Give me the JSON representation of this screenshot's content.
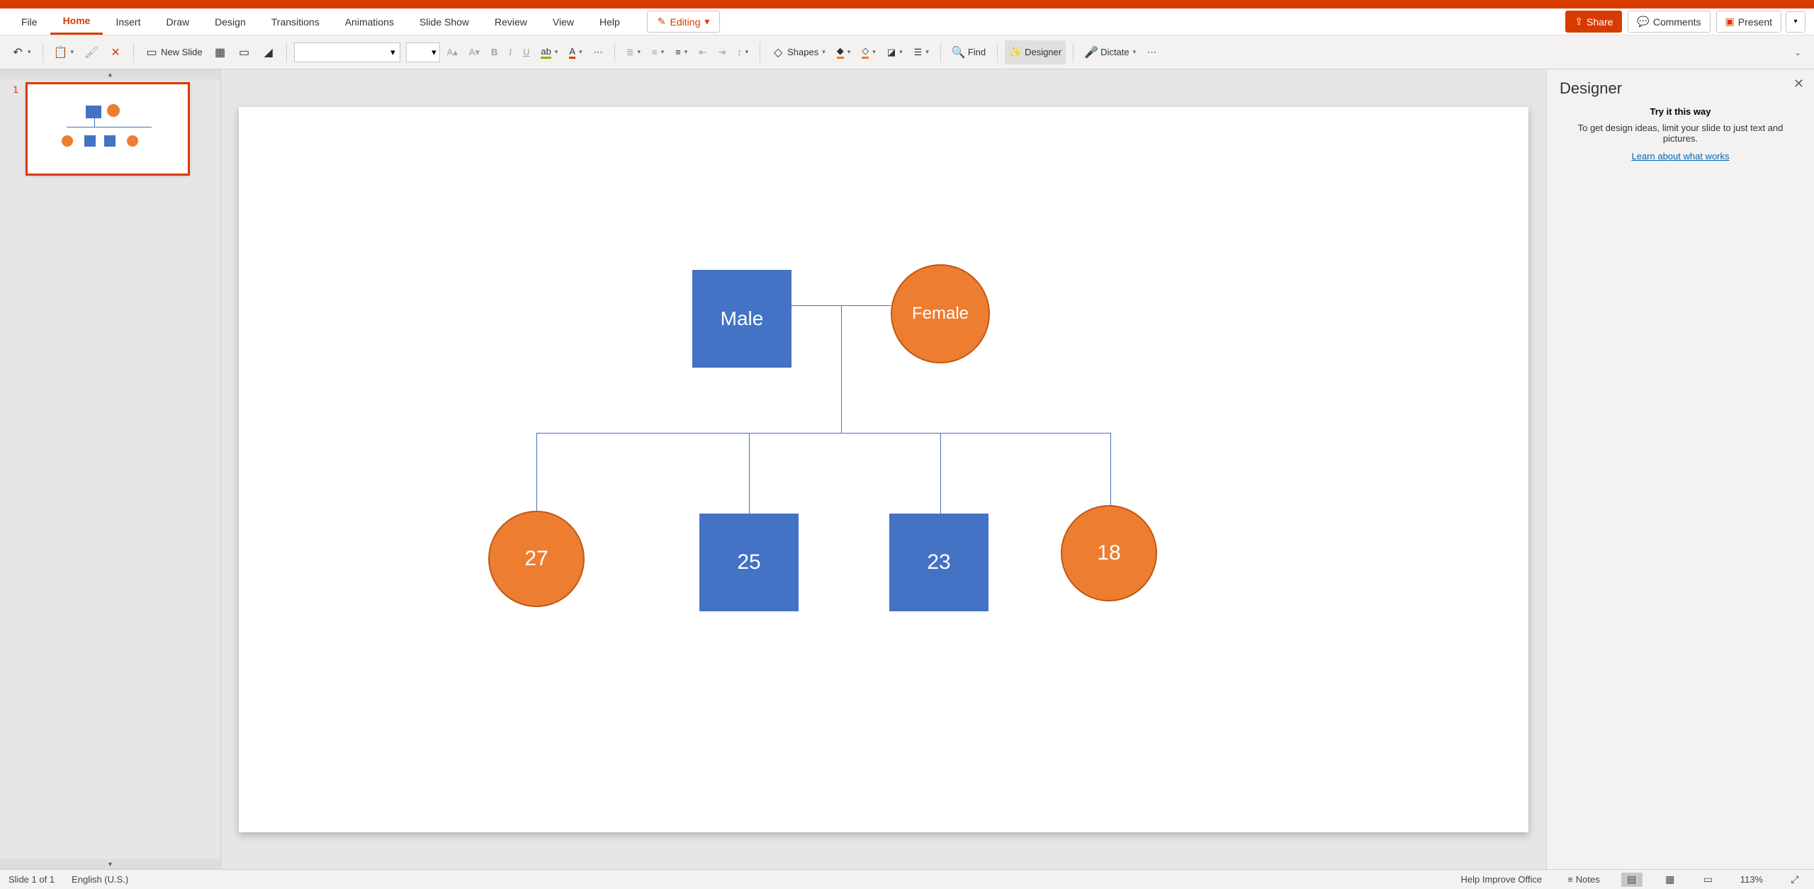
{
  "tabs": [
    "File",
    "Home",
    "Insert",
    "Draw",
    "Design",
    "Transitions",
    "Animations",
    "Slide Show",
    "Review",
    "View",
    "Help"
  ],
  "activeTab": "Home",
  "editing": "Editing",
  "topRight": {
    "share": "Share",
    "comments": "Comments",
    "present": "Present"
  },
  "toolbar": {
    "newSlide": "New Slide",
    "shapes": "Shapes",
    "find": "Find",
    "designer": "Designer",
    "dictate": "Dictate"
  },
  "thumb": {
    "number": "1"
  },
  "slide": {
    "male": "Male",
    "female": "Female",
    "c1": "27",
    "c2": "25",
    "c3": "23",
    "c4": "18"
  },
  "designerPanel": {
    "title": "Designer",
    "subtitle": "Try it this way",
    "message": "To get design ideas, limit your slide to just text and pictures.",
    "link": "Learn about what works"
  },
  "status": {
    "slideInfo": "Slide 1 of 1",
    "lang": "English (U.S.)",
    "help": "Help Improve Office",
    "notes": "Notes",
    "zoom": "113%"
  }
}
